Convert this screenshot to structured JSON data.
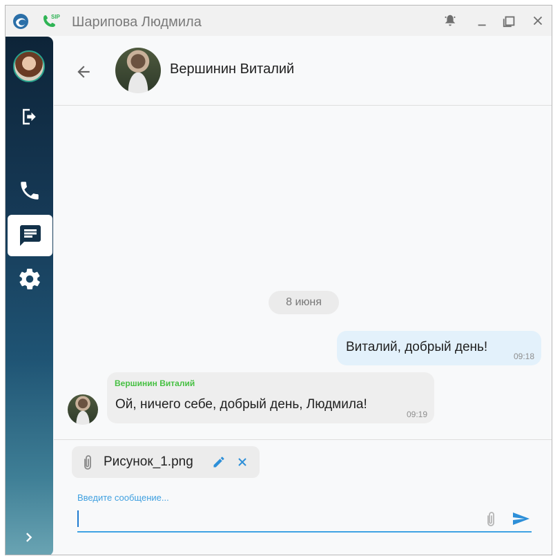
{
  "window": {
    "title": "Шарипова Людмила",
    "icons": [
      "app-logo-icon",
      "sip-phone-icon",
      "bell-icon",
      "minimize-icon",
      "maximize-icon",
      "close-icon"
    ]
  },
  "sidebar": {
    "items": [
      {
        "name": "profile-avatar"
      },
      {
        "name": "logout-icon"
      },
      {
        "name": "phone-icon"
      },
      {
        "name": "chat-icon",
        "active": true
      },
      {
        "name": "gear-icon"
      },
      {
        "name": "chevron-right-icon"
      }
    ]
  },
  "header": {
    "contact_name": "Вершинин Виталий"
  },
  "messages": {
    "date_separator": "8 июня",
    "items": [
      {
        "direction": "out",
        "text": "Виталий, добрый день!",
        "time": "09:18"
      },
      {
        "direction": "in",
        "sender": "Вершинин Виталий",
        "text": "Ой, ничего себе, добрый день, Людмила!",
        "time": "09:19"
      }
    ]
  },
  "composer": {
    "attachment_name": "Рисунок_1.png",
    "input_label": "Введите сообщение...",
    "input_value": ""
  },
  "colors": {
    "accent": "#3ea2e3",
    "sender_name": "#46c042",
    "outgoing_bubble": "#e3f1fb",
    "incoming_bubble": "#eeeeee",
    "sidebar_dark": "#0d2438"
  }
}
